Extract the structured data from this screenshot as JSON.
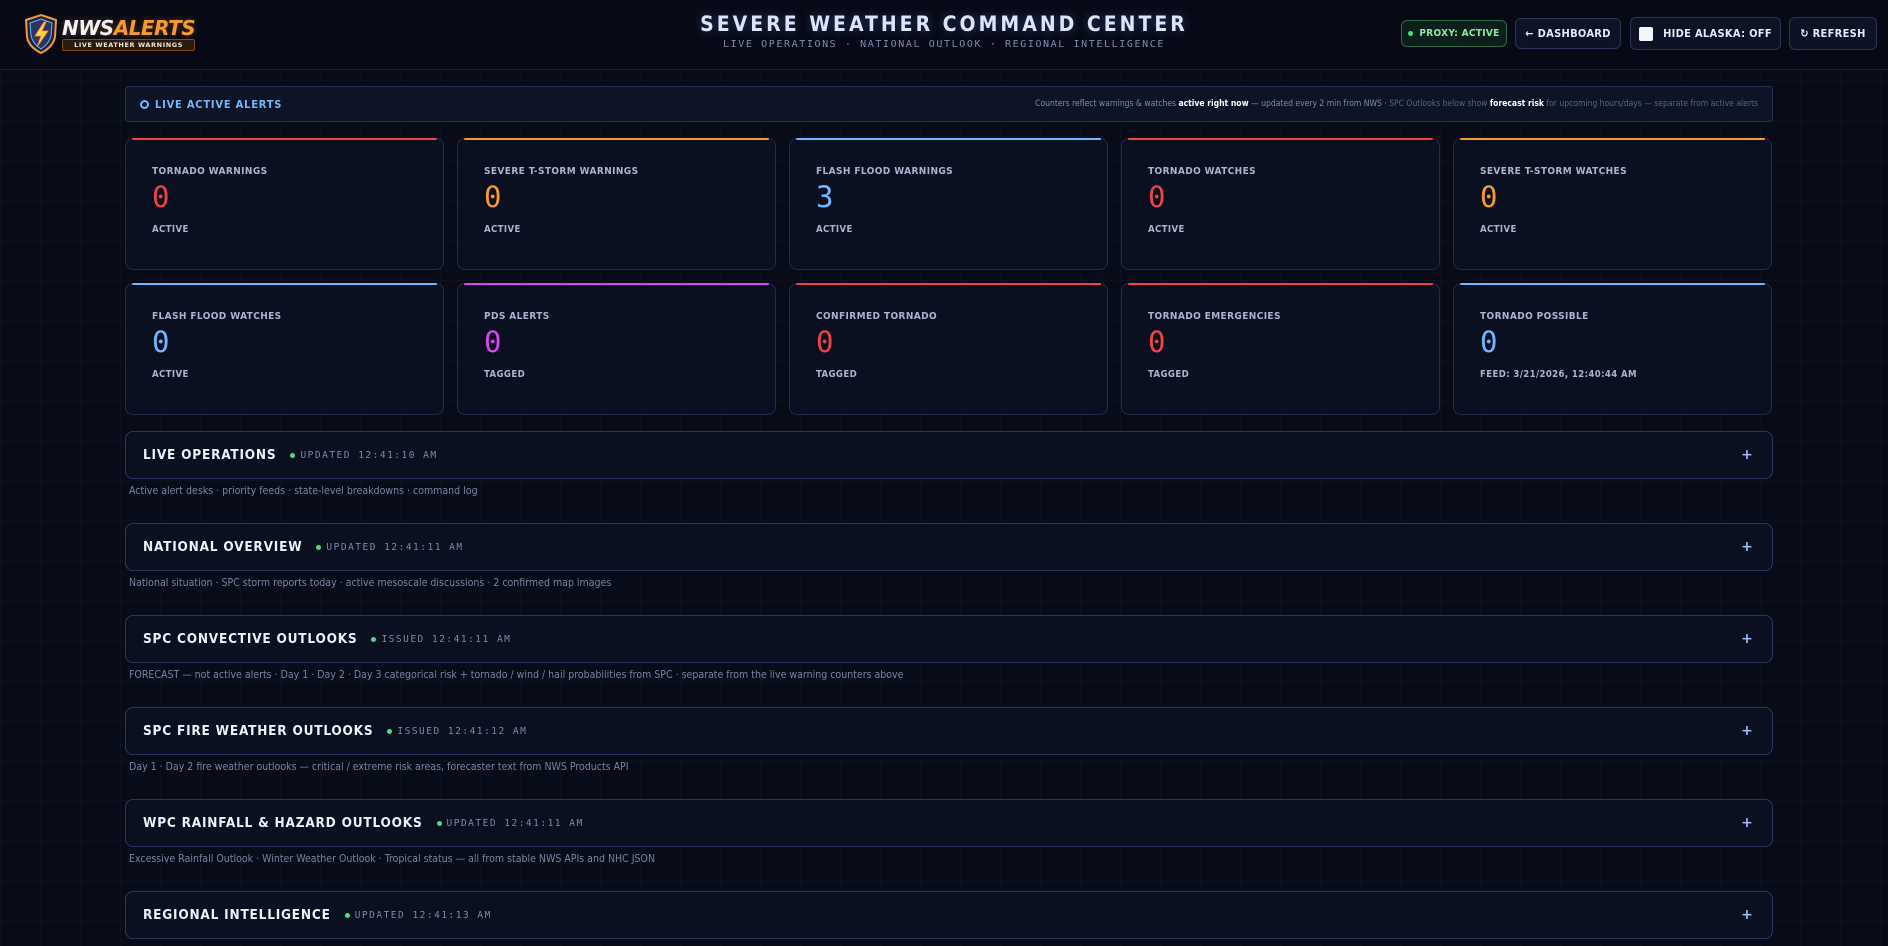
{
  "header": {
    "logo_main": "NWS",
    "logo_accent": "ALERTS",
    "logo_sub": "LIVE WEATHER WARNINGS",
    "title": "SEVERE WEATHER COMMAND CENTER",
    "subtitle": "LIVE OPERATIONS · NATIONAL OUTLOOK · REGIONAL INTELLIGENCE",
    "proxy_label": "PROXY: ACTIVE",
    "dashboard_label": "← DASHBOARD",
    "alaska_label": "HIDE ALASKA: OFF",
    "refresh_label": "↻ REFRESH"
  },
  "live": {
    "title": "LIVE ACTIVE ALERTS",
    "note_1": "Counters reflect warnings & watches ",
    "note_bold_1": "active right now",
    "note_2": " — updated every 2 min from NWS · ",
    "note_3": "SPC Outlooks below show ",
    "note_bold_2": "forecast risk",
    "note_4": " for upcoming hours/days — separate from active alerts"
  },
  "cards": [
    {
      "label": "TORNADO WARNINGS",
      "value": "0",
      "sub": "ACTIVE",
      "color": "#ef4444"
    },
    {
      "label": "SEVERE T-STORM WARNINGS",
      "value": "0",
      "sub": "ACTIVE",
      "color": "#f59a2c"
    },
    {
      "label": "FLASH FLOOD WARNINGS",
      "value": "3",
      "sub": "ACTIVE",
      "color": "#6fb8ff"
    },
    {
      "label": "TORNADO WATCHES",
      "value": "0",
      "sub": "ACTIVE",
      "color": "#ef4444"
    },
    {
      "label": "SEVERE T-STORM WATCHES",
      "value": "0",
      "sub": "ACTIVE",
      "color": "#f59a2c"
    },
    {
      "label": "FLASH FLOOD WATCHES",
      "value": "0",
      "sub": "ACTIVE",
      "color": "#6fb8ff"
    },
    {
      "label": "PDS ALERTS",
      "value": "0",
      "sub": "TAGGED",
      "color": "#d946ef"
    },
    {
      "label": "CONFIRMED TORNADO",
      "value": "0",
      "sub": "TAGGED",
      "color": "#ef4444"
    },
    {
      "label": "TORNADO EMERGENCIES",
      "value": "0",
      "sub": "TAGGED",
      "color": "#ef4444"
    },
    {
      "label": "TORNADO POSSIBLE",
      "value": "0",
      "sub": "FEED: 3/21/2026, 12:40:44 AM",
      "color": "#6fb8ff"
    }
  ],
  "sections": [
    {
      "title": "LIVE OPERATIONS",
      "status": "UPDATED 12:41:10 AM",
      "desc": "Active alert desks · priority feeds · state-level breakdowns · command log"
    },
    {
      "title": "NATIONAL OVERVIEW",
      "status": "UPDATED 12:41:11 AM",
      "desc": "National situation · SPC storm reports today · active mesoscale discussions · 2 confirmed map images"
    },
    {
      "title": "SPC CONVECTIVE OUTLOOKS",
      "status": "ISSUED 12:41:11 AM",
      "desc": "FORECAST — not active alerts · Day 1 · Day 2 · Day 3 categorical risk + tornado / wind / hail probabilities from SPC · separate from the live warning counters above"
    },
    {
      "title": "SPC FIRE WEATHER OUTLOOKS",
      "status": "ISSUED 12:41:12 AM",
      "desc": "Day 1 · Day 2 fire weather outlooks — critical / extreme risk areas, forecaster text from NWS Products API"
    },
    {
      "title": "WPC RAINFALL & HAZARD OUTLOOKS",
      "status": "UPDATED 12:41:11 AM",
      "desc": "Excessive Rainfall Outlook · Winter Weather Outlook · Tropical status — all from stable NWS APIs and NHC JSON"
    },
    {
      "title": "REGIONAL INTELLIGENCE",
      "status": "UPDATED 12:41:13 AM",
      "desc": ""
    }
  ],
  "icons": {
    "logo": "shield-lightning-icon",
    "expand": "plus-icon",
    "status": "status-dot-icon",
    "live": "ring-icon"
  },
  "colors": {
    "background": "#080b18",
    "accent_blue": "#6fb8ff",
    "status_green": "#4ade80",
    "red": "#ef4444",
    "orange": "#f59a2c",
    "magenta": "#d946ef"
  }
}
